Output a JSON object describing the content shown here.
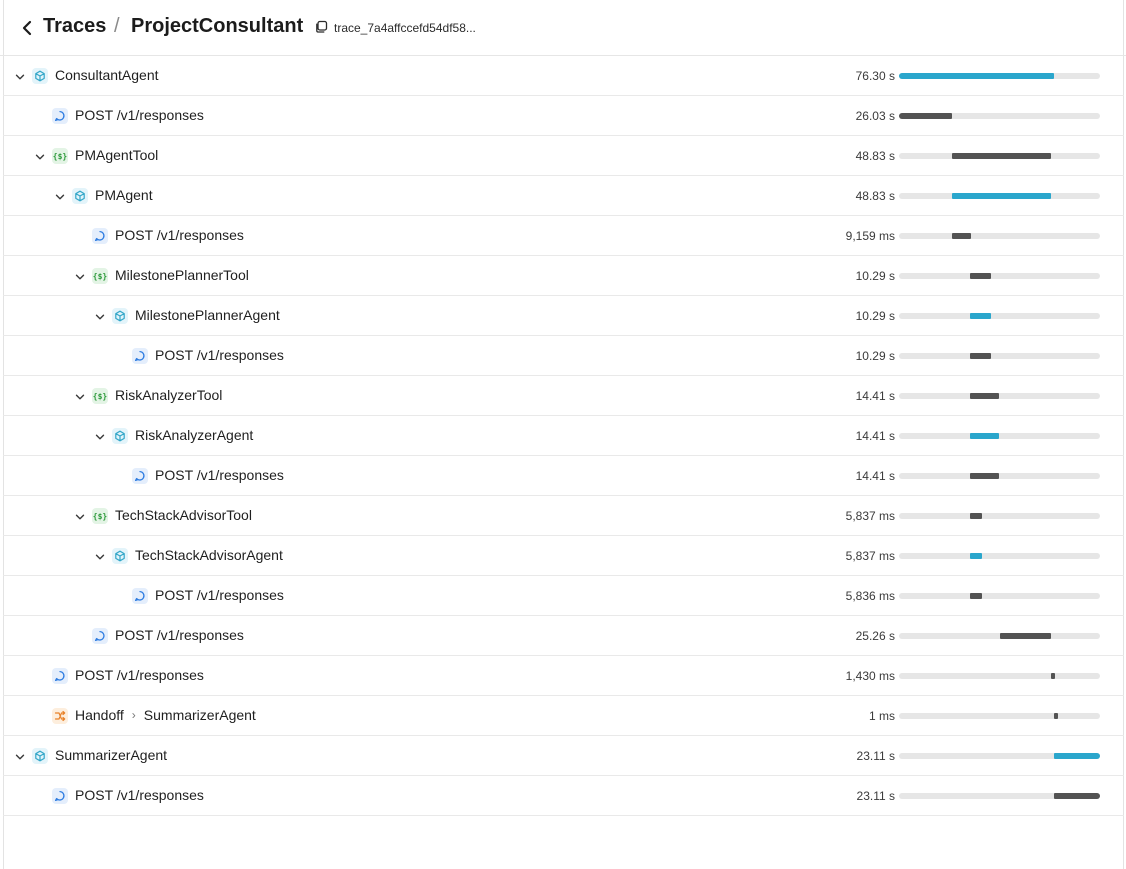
{
  "header": {
    "root_label": "Traces",
    "separator": "/",
    "title": "ProjectConsultant",
    "trace_id": "trace_7a4affccefd54df58..."
  },
  "colors": {
    "agent_bar": "#2aa6cc",
    "call_bar": "#535353",
    "track": "#e6e6e6",
    "agent_icon": "#33a7c9",
    "call_icon": "#2f7de1",
    "tool_icon": "#2e9a3c",
    "handoff_icon": "#e8822a"
  },
  "spans": [
    {
      "name": "ConsultantAgent",
      "type": "agent",
      "depth": 0,
      "expandable": true,
      "duration": "76.30 s",
      "start": 0.0,
      "end": 0.769
    },
    {
      "name": "POST /v1/responses",
      "type": "call",
      "depth": 1,
      "expandable": false,
      "duration": "26.03 s",
      "start": 0.0,
      "end": 0.262
    },
    {
      "name": "PMAgentTool",
      "type": "tool",
      "depth": 1,
      "expandable": true,
      "duration": "48.83 s",
      "start": 0.262,
      "end": 0.756
    },
    {
      "name": "PMAgent",
      "type": "agent",
      "depth": 2,
      "expandable": true,
      "duration": "48.83 s",
      "start": 0.262,
      "end": 0.756
    },
    {
      "name": "POST /v1/responses",
      "type": "call",
      "depth": 3,
      "expandable": false,
      "duration": "9,159 ms",
      "start": 0.262,
      "end": 0.355
    },
    {
      "name": "MilestonePlannerTool",
      "type": "tool",
      "depth": 3,
      "expandable": true,
      "duration": "10.29 s",
      "start": 0.355,
      "end": 0.459
    },
    {
      "name": "MilestonePlannerAgent",
      "type": "agent",
      "depth": 4,
      "expandable": true,
      "duration": "10.29 s",
      "start": 0.355,
      "end": 0.459
    },
    {
      "name": "POST /v1/responses",
      "type": "call",
      "depth": 5,
      "expandable": false,
      "duration": "10.29 s",
      "start": 0.355,
      "end": 0.459
    },
    {
      "name": "RiskAnalyzerTool",
      "type": "tool",
      "depth": 3,
      "expandable": true,
      "duration": "14.41 s",
      "start": 0.355,
      "end": 0.5
    },
    {
      "name": "RiskAnalyzerAgent",
      "type": "agent",
      "depth": 4,
      "expandable": true,
      "duration": "14.41 s",
      "start": 0.355,
      "end": 0.5
    },
    {
      "name": "POST /v1/responses",
      "type": "call",
      "depth": 5,
      "expandable": false,
      "duration": "14.41 s",
      "start": 0.355,
      "end": 0.5
    },
    {
      "name": "TechStackAdvisorTool",
      "type": "tool",
      "depth": 3,
      "expandable": true,
      "duration": "5,837 ms",
      "start": 0.355,
      "end": 0.415
    },
    {
      "name": "TechStackAdvisorAgent",
      "type": "agent",
      "depth": 4,
      "expandable": true,
      "duration": "5,837 ms",
      "start": 0.355,
      "end": 0.415
    },
    {
      "name": "POST /v1/responses",
      "type": "call",
      "depth": 5,
      "expandable": false,
      "duration": "5,836 ms",
      "start": 0.355,
      "end": 0.415
    },
    {
      "name": "POST /v1/responses",
      "type": "call",
      "depth": 3,
      "expandable": false,
      "duration": "25.26 s",
      "start": 0.5,
      "end": 0.756
    },
    {
      "name": "POST /v1/responses",
      "type": "call",
      "depth": 1,
      "expandable": false,
      "duration": "1,430 ms",
      "start": 0.756,
      "end": 0.771
    },
    {
      "name": "Handoff",
      "target": "SummarizerAgent",
      "type": "handoff",
      "depth": 1,
      "expandable": false,
      "duration": "1 ms",
      "start": 0.771,
      "end": 0.779
    },
    {
      "name": "SummarizerAgent",
      "type": "agent",
      "depth": 0,
      "expandable": true,
      "duration": "23.11 s",
      "start": 0.771,
      "end": 1.0
    },
    {
      "name": "POST /v1/responses",
      "type": "call",
      "depth": 1,
      "expandable": false,
      "duration": "23.11 s",
      "start": 0.771,
      "end": 1.0
    }
  ]
}
